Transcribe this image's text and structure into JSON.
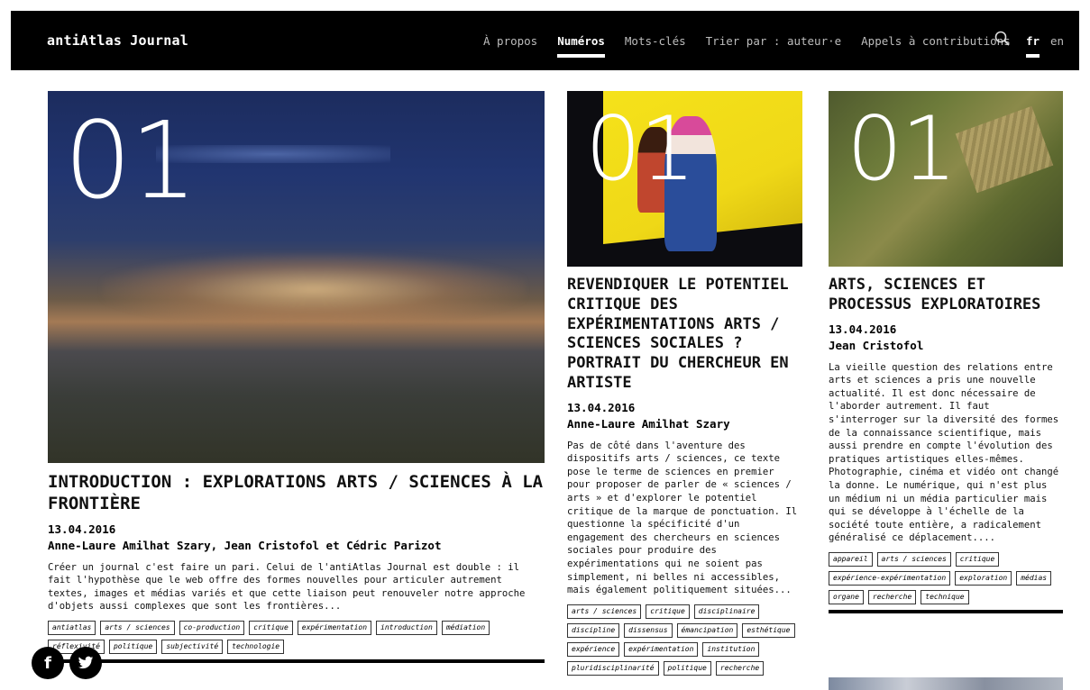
{
  "header": {
    "brand": "antiAtlas Journal",
    "nav": [
      {
        "label": "À propos",
        "active": false
      },
      {
        "label": "Numéros",
        "active": true
      },
      {
        "label": "Mots-clés",
        "active": false
      },
      {
        "label": "Trier par : auteur·e",
        "active": false
      },
      {
        "label": "Appels à contributions",
        "active": false
      }
    ],
    "search_icon": "search-icon",
    "lang_fr": "fr",
    "lang_en": "en"
  },
  "cards": [
    {
      "issue": "01",
      "title": "INTRODUCTION : EXPLORATIONS ARTS / SCIENCES À LA FRONTIÈRE",
      "date": "13.04.2016",
      "authors": "Anne-Laure Amilhat Szary, Jean Cristofol et Cédric Parizot",
      "excerpt": "Créer un journal c'est faire un pari. Celui de l'antiAtlas Journal est double : il fait l'hypothèse que le web offre des formes nouvelles pour articuler autrement textes, images et médias variés et que cette liaison peut renouveler notre approche d'objets aussi complexes que sont les frontières...",
      "tags": [
        "antiatlas",
        "arts / sciences",
        "co-production",
        "critique",
        "expérimentation",
        "introduction",
        "médiation",
        "réflexivité",
        "politique",
        "réflexivité",
        "subjectivité",
        "technologie"
      ]
    },
    {
      "issue": "01",
      "title": "REVENDIQUER LE POTENTIEL CRITIQUE DES EXPÉRIMENTATIONS ARTS / SCIENCES SOCIALES ? PORTRAIT DU CHERCHEUR EN ARTISTE",
      "date": "13.04.2016",
      "authors": "Anne-Laure Amilhat Szary",
      "excerpt": "Pas de côté dans l'aventure des dispositifs arts / sciences, ce texte pose le terme de sciences en premier pour proposer de parler de « sciences / arts » et d'explorer le potentiel critique de la marque de ponctuation. Il questionne la spécificité d'un engagement des chercheurs en sciences sociales pour produire des expérimentations qui ne soient pas simplement, ni belles ni accessibles, mais également politiquement situées...",
      "tags": [
        "arts / sciences",
        "critique",
        "disciplinaire",
        "discipline",
        "dissensus",
        "émancipation",
        "esthétique",
        "expérience",
        "expérimentation",
        "institution",
        "pluridisciplinarité",
        "politique",
        "recherche"
      ]
    },
    {
      "issue": "01",
      "title": "ARTS, SCIENCES ET PROCESSUS EXPLORATOIRES",
      "date": "13.04.2016",
      "authors": "Jean Cristofol",
      "excerpt": "La vieille question des relations entre arts et sciences a pris une nouvelle actualité. Il est donc nécessaire de l'aborder autrement. Il faut s'interroger sur la diversité des formes de la connaissance scientifique, mais aussi prendre en compte l'évolution des pratiques artistiques elles-mêmes. Photographie, cinéma et vidéo ont changé la donne. Le numérique, qui n'est plus un médium ni un média particulier mais qui se développe à l'échelle de la société toute entière, a radicalement généralisé ce déplacement....",
      "tags": [
        "appareil",
        "arts / sciences",
        "critique",
        "expérience-expérimentation",
        "exploration",
        "médias",
        "organe",
        "recherche",
        "technique"
      ]
    }
  ],
  "social": {
    "facebook": "f",
    "twitter": "twitter-icon"
  }
}
